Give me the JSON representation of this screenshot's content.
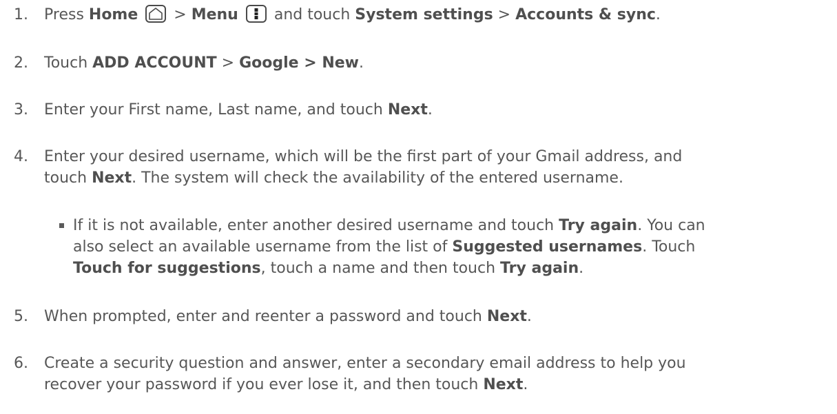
{
  "steps": [
    {
      "number": "1.",
      "press": "Press ",
      "home": "Home",
      "home_icon": "home-icon",
      "sep1": " > ",
      "menu": "Menu",
      "menu_icon": "menu-icon",
      "and_touch": " and touch ",
      "system_settings": "System settings",
      "sep2": " > ",
      "accounts_sync": "Accounts & sync",
      "end": "."
    },
    {
      "number": "2.",
      "touch": "Touch ",
      "add_account": "ADD ACCOUNT",
      "sep": " > ",
      "google_new": "Google > New",
      "end": "."
    },
    {
      "number": "3.",
      "text": "Enter your First name, Last name, and touch ",
      "next": "Next",
      "end": "."
    },
    {
      "number": "4.",
      "line1": "Enter your desired username, which will be the first part of your Gmail address, and",
      "touch": "touch ",
      "next": "Next",
      "line2_rest": ". The system will check the availability of the entered username."
    },
    {
      "number": "5.",
      "text": "When prompted, enter and reenter a password and touch ",
      "next": "Next",
      "end": "."
    },
    {
      "number": "6.",
      "line1": "Create a security question and answer, enter a secondary email address to help you",
      "line2": "recover your password if you ever lose it, and then touch ",
      "next": "Next",
      "end": "."
    }
  ],
  "substep": {
    "line1_a": "If it is not available, enter another desired username and touch ",
    "try_again": "Try again",
    "line1_b": ". You can",
    "line2_a": "also select an available username from the list of ",
    "suggested": "Suggested usernames",
    "line2_b": ". Touch",
    "touch_for_suggestions": "Touch for suggestions",
    "line3_a": ", touch a name and then touch ",
    "try_again_2": "Try again",
    "line3_b": "."
  }
}
